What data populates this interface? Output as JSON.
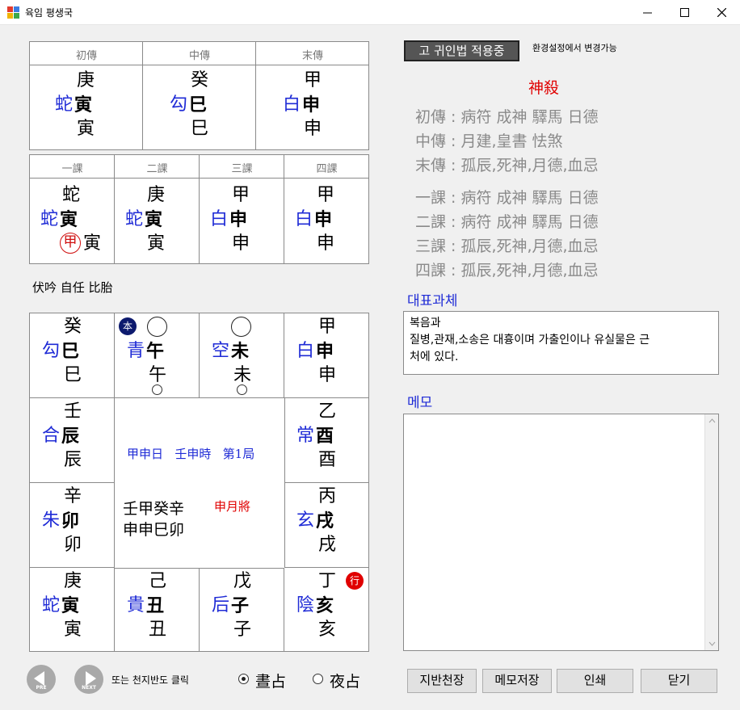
{
  "window": {
    "title": "육임 평생국"
  },
  "chuanzhuan": {
    "headers": [
      "初傳",
      "中傳",
      "末傳"
    ],
    "cells": [
      {
        "top": "庚",
        "god": "蛇",
        "branch": "寅",
        "bottom": "寅"
      },
      {
        "top": "癸",
        "god": "勾",
        "branch": "巳",
        "bottom": "巳"
      },
      {
        "top": "甲",
        "god": "白",
        "branch": "申",
        "bottom": "申"
      }
    ]
  },
  "sike": {
    "headers": [
      "一課",
      "二課",
      "三課",
      "四課"
    ],
    "cells": [
      {
        "top": "蛇",
        "god": "蛇",
        "branch": "寅",
        "circle": "甲",
        "bottom": "寅"
      },
      {
        "top": "庚",
        "god": "蛇",
        "branch": "寅",
        "bottom": "寅"
      },
      {
        "top": "甲",
        "god": "白",
        "branch": "申",
        "bottom": "申"
      },
      {
        "top": "甲",
        "god": "白",
        "branch": "申",
        "bottom": "申"
      }
    ]
  },
  "keti": {
    "text": "伏吟 自任 比胎"
  },
  "board": {
    "cells": [
      {
        "top": "癸",
        "god": "勾",
        "branch": "巳",
        "bottom": "巳"
      },
      {
        "top": "",
        "god": "青",
        "branch": "午",
        "bottom": "午",
        "badge": "本"
      },
      {
        "top": "",
        "god": "空",
        "branch": "未",
        "bottom": "未"
      },
      {
        "top": "甲",
        "god": "白",
        "branch": "申",
        "bottom": "申"
      },
      {
        "top": "壬",
        "god": "合",
        "branch": "辰",
        "bottom": "辰"
      },
      {
        "top": "乙",
        "god": "常",
        "branch": "酉",
        "bottom": "酉"
      },
      {
        "top": "辛",
        "god": "朱",
        "branch": "卯",
        "bottom": "卯"
      },
      {
        "top": "丙",
        "god": "玄",
        "branch": "戌",
        "bottom": "戌"
      },
      {
        "top": "庚",
        "god": "蛇",
        "branch": "寅",
        "bottom": "寅"
      },
      {
        "top": "己",
        "god": "貴",
        "branch": "丑",
        "bottom": "丑"
      },
      {
        "top": "戊",
        "god": "后",
        "branch": "子",
        "bottom": "子"
      },
      {
        "top": "丁",
        "god": "陰",
        "branch": "亥",
        "bottom": "亥",
        "badge": "行"
      }
    ],
    "center": {
      "day": "甲申日",
      "time": "壬申時",
      "ju": "第1局",
      "stems": "壬甲癸辛",
      "branches": "申申巳卯",
      "yuejiang": "申月將"
    }
  },
  "nav": {
    "prev_label": "PRE",
    "next_label": "NEXT",
    "hint": "또는 천지반도 클릭",
    "radio_day": "晝占",
    "radio_night": "夜占",
    "selected": "day"
  },
  "right": {
    "guiren_button": "고 귀인법 적용중",
    "setting_hint": "환경설정에서 변경가능",
    "shinsal_title": "神殺",
    "shinsal_lines": [
      "初傳 : 病符 成神 驛馬 日德",
      "中傳 :  月建,皇書 怯煞",
      "末傳 :  孤辰,死神,月德,血忌",
      "一課 : 病符 成神 驛馬 日德",
      "二課 : 病符 成神 驛馬 日德",
      "三課 :  孤辰,死神,月德,血忌",
      "四課 :  孤辰,死神,月德,血忌"
    ],
    "repr_title": "대표과체",
    "repr_line1": "복음과",
    "repr_line2": "질병,관재,소송은 대흉이며 가출인이나 유실물은 근",
    "repr_line3": "처에 있다.",
    "memo_title": "메모",
    "memo_value": ""
  },
  "buttons": {
    "jiban": "지반천장",
    "memo_save": "메모저장",
    "print": "인쇄",
    "close": "닫기"
  },
  "colors": {
    "blue": "#1f2bd6",
    "red": "#e00000",
    "gray": "#8a8a8a",
    "badge_navy": "#0d1a6e",
    "badge_red": "#e00000"
  }
}
